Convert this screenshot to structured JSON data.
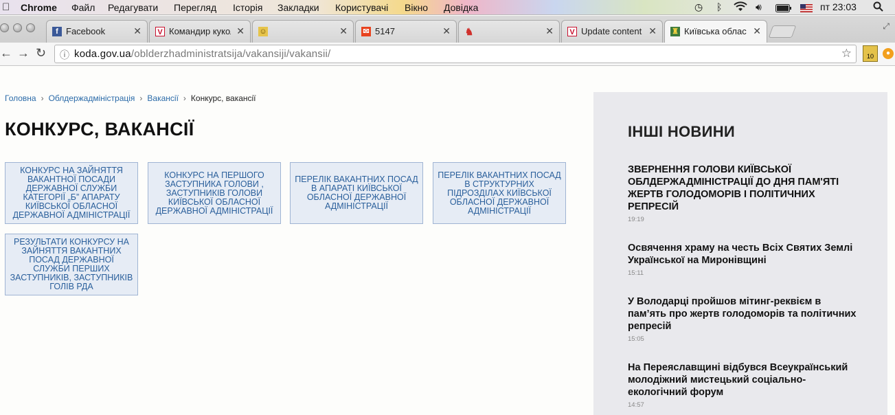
{
  "menubar": {
    "app": "Chrome",
    "items": [
      "Файл",
      "Редагувати",
      "Перегляд",
      "Історія",
      "Закладки",
      "Користувачі",
      "Вікно",
      "Довідка"
    ],
    "clock": "пт 23:03"
  },
  "tabs": [
    {
      "title": "Facebook",
      "icon": "facebook-icon",
      "color": "#3b5998",
      "glyph": "f"
    },
    {
      "title": "Командир кукол",
      "icon": "v-logo-icon",
      "color": "#c8102e",
      "glyph": "V"
    },
    {
      "title": "",
      "icon": "emoji-icon",
      "color": "#e6c44b",
      "glyph": "☺"
    },
    {
      "title": "5147",
      "icon": "mail-icon",
      "color": "#e8421e",
      "glyph": "✉"
    },
    {
      "title": "",
      "icon": "cat-icon",
      "color": "#d0312d",
      "glyph": "♞"
    },
    {
      "title": "Update content",
      "icon": "v-logo-icon",
      "color": "#c8102e",
      "glyph": "V"
    },
    {
      "title": "Київська облас",
      "icon": "coat-of-arms-icon",
      "color": "#3c7a3c",
      "glyph": "♜",
      "active": true
    }
  ],
  "toolbar": {
    "url_host": "koda.gov.ua",
    "url_path": "/oblderzhadministratsija/vakansiji/vakansii/",
    "ext_badge": "10"
  },
  "breadcrumb": {
    "items": [
      "Головна",
      "Облдержадміністрація",
      "Вакансії"
    ],
    "current": "Конкурс, вакансії"
  },
  "page_title": "КОНКУРС, ВАКАНСІЇ",
  "cards": [
    "Конкурс на зайняття вакантної посади державної служби категорії „Б” апарату Київської обласної державної адміністрації",
    "Конкурс на першого заступника голови , заступників голови Київської обласної державної адміністрації",
    "Перелік вакантних посад в апараті Київської обласної державної адміністрації",
    "Перелік вакантних посад в структурних підрозділах Київської обласної державної адміністрації",
    "Результати конкурсу на зайняття вакантних посад державної служби перших заступників, заступників голів РДА"
  ],
  "sidebar": {
    "title": "ІНШІ НОВИНИ",
    "news": [
      {
        "headline": "ЗВЕРНЕННЯ ГОЛОВИ КИЇВСЬКОЇ ОБЛДЕРЖАДМІНІСТРАЦІЇ ДО ДНЯ ПАМ'ЯТІ ЖЕРТВ ГОЛОДОМОРІВ І ПОЛІТИЧНИХ РЕПРЕСІЙ",
        "time": "19:19"
      },
      {
        "headline": "Освячення храму на честь Всіх Святих Землі Української на Миронівщині",
        "time": "15:11"
      },
      {
        "headline": "У Володарці пройшов мітинг-реквієм в пам’ять про жертв голодоморів та політичних репресій",
        "time": "15:05"
      },
      {
        "headline": "На Переяславщині відбувся Всеукраїнський молодіжний мистецький соціально-екологічний форум",
        "time": "14:57"
      }
    ]
  }
}
